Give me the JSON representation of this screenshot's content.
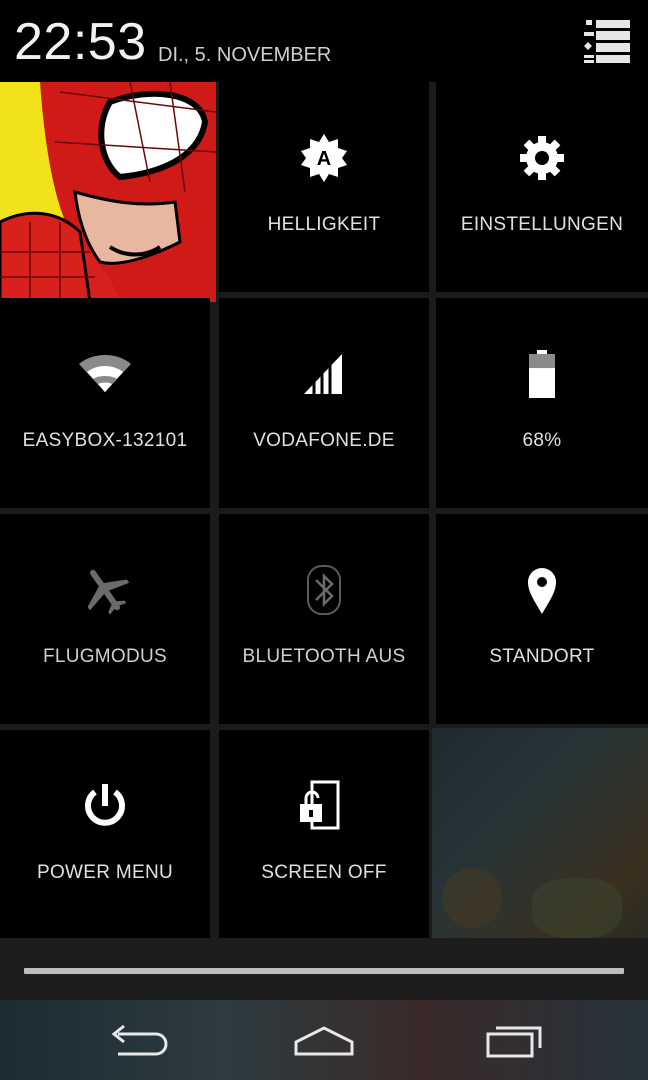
{
  "status": {
    "time": "22:53",
    "date": "DI., 5. NOVEMBER",
    "menu_icon": "settings-list-icon"
  },
  "tiles": [
    {
      "id": "user",
      "icon": "spiderman-avatar",
      "label": ""
    },
    {
      "id": "brightness",
      "icon": "auto-brightness-icon",
      "label": "HELLIGKEIT"
    },
    {
      "id": "settings",
      "icon": "gear-icon",
      "label": "EINSTELLUNGEN"
    },
    {
      "id": "wifi",
      "icon": "wifi-icon",
      "label": "EASYBOX-132101"
    },
    {
      "id": "mobile",
      "icon": "signal-icon",
      "label": "VODAFONE.DE"
    },
    {
      "id": "battery",
      "icon": "battery-icon",
      "label": "68%"
    },
    {
      "id": "airplane",
      "icon": "airplane-icon",
      "label": "FLUGMODUS"
    },
    {
      "id": "bluetooth",
      "icon": "bluetooth-icon",
      "label": "BLUETOOTH AUS"
    },
    {
      "id": "location",
      "icon": "location-pin-icon",
      "label": "STANDORT"
    },
    {
      "id": "power",
      "icon": "power-icon",
      "label": "POWER MENU"
    },
    {
      "id": "screenoff",
      "icon": "screen-lock-icon",
      "label": "SCREEN OFF"
    }
  ],
  "battery_level": 0.68,
  "nav": {
    "back": "back-icon",
    "home": "home-icon",
    "recents": "recents-icon"
  },
  "colors": {
    "background": "#000000",
    "divider": "#1b1b1b",
    "label": "#e0e0e0",
    "icon_white": "#ffffff",
    "icon_dim": "#6b6b6b"
  }
}
